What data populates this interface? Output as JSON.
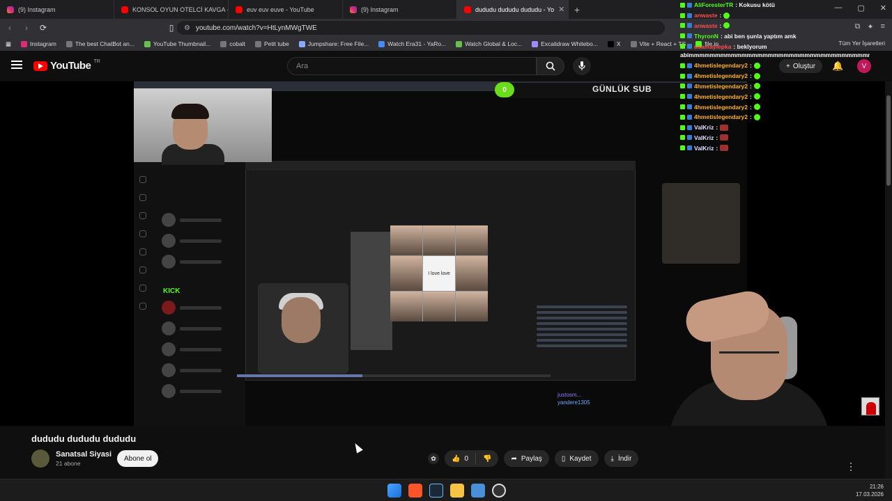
{
  "browser": {
    "tabs": [
      {
        "label": "(9) Instagram",
        "kind": "ig"
      },
      {
        "label": "KONSOL OYUN OTELCİ KAVGA - You",
        "kind": "yt"
      },
      {
        "label": "euv euv euve - YouTube",
        "kind": "yt"
      },
      {
        "label": "(9) Instagram",
        "kind": "ig"
      },
      {
        "label": "dududu dududu dududu - Yo",
        "kind": "yt"
      }
    ],
    "url": "youtube.com/watch?v=HtLynMWgTWE",
    "bookmarks": [
      "Instagram",
      "The best ChatBot an...",
      "YouTube Thumbnail...",
      "cobalt",
      "Petit tube",
      "Jumpshare: Free File...",
      "Watch Era31 - YaRo...",
      "Watch Global & Loc...",
      "Excalidraw Whitebo...",
      "X",
      "Vite + React + TS",
      "file.io"
    ],
    "bookmarks_all": "Tüm Yer İşaretleri"
  },
  "youtube": {
    "logo_text": "YouTube",
    "region": "TR",
    "search_placeholder": "Ara",
    "create_label": "Oluştur",
    "avatar_letter": "V"
  },
  "stream": {
    "sub_counter": "0",
    "sub_label": "GÜNLÜK SUB",
    "collage_text": "I love love",
    "kick_label": "KICK",
    "chat_bottom": [
      "justosm...",
      "yandere1305"
    ]
  },
  "chat_overlay": {
    "lines": [
      {
        "user": "AliForesterTR",
        "color": "#53fc18",
        "msg": ": Kokusu kötü",
        "emote": false
      },
      {
        "user": "anwaste",
        "color": "#ff4d4d",
        "msg": ":",
        "emote": true
      },
      {
        "user": "anwaste",
        "color": "#ff4d4d",
        "msg": ":",
        "emote": true
      },
      {
        "user": "ThyronN",
        "color": "#53fc18",
        "msg": ": abi ben şunla yaptım amk",
        "emote": false
      },
      {
        "user": "usamaylepka",
        "color": "#ff4d4d",
        "msg": ": beklyorum",
        "emote": false
      },
      {
        "user": "4hmetislegendary2",
        "color": "#ffb020",
        "msg": ":",
        "emote": true
      },
      {
        "user": "4hmetislegendary2",
        "color": "#ffb020",
        "msg": ":",
        "emote": true
      },
      {
        "user": "4hmetislegendary2",
        "color": "#ffb020",
        "msg": ":",
        "emote": true
      },
      {
        "user": "4hmetislegendary2",
        "color": "#ffb020",
        "msg": ":",
        "emote": true
      },
      {
        "user": "4hmetislegendary2",
        "color": "#ffb020",
        "msg": ":",
        "emote": true
      },
      {
        "user": "4hmetislegendary2",
        "color": "#ffb020",
        "msg": ":",
        "emote": true
      }
    ],
    "spam": "abimmmmmmmmmmmmmmmmmmmmmmmmmmmmmmmmmmmmmmmmmmmm",
    "valkriz": [
      "ValKriz",
      "ValKriz",
      "ValKriz"
    ]
  },
  "video": {
    "title": "dududu dududu dududu",
    "channel": "Sanatsal Siyasi",
    "subscribers": "21 abone",
    "subscribe_label": "Abone ol",
    "likes": "0",
    "share_label": "Paylaş",
    "save_label": "Kaydet",
    "download_label": "İndir"
  },
  "taskbar": {
    "time": "21:26",
    "date": "17.03.2026"
  }
}
